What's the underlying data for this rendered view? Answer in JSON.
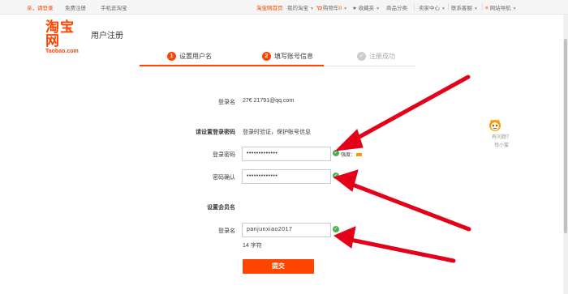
{
  "topbar": {
    "greeting": "亲，请登录",
    "free_register": "免费注册",
    "mobile": "手机逛淘宝",
    "home": "淘宝网首页",
    "my_taobao": "我的淘宝",
    "cart": "购物车",
    "cart_count": "0",
    "favorites": "收藏夹",
    "categories": "商品分类",
    "seller": "卖家中心",
    "service": "联系客服",
    "site_nav": "网站导航"
  },
  "header": {
    "logo_cn": "淘宝网",
    "logo_en": "Taobao.com",
    "title": "用户注册"
  },
  "steps": [
    {
      "num": "1",
      "label": "设置用户名"
    },
    {
      "num": "2",
      "label": "填写账号信息"
    },
    {
      "num": "✓",
      "label": "注册成功"
    }
  ],
  "form": {
    "account_label": "登录名",
    "account_value": "27€   21791@qq.com",
    "password_section": "请设置登录密码",
    "password_section_note": "登录时验证，保护账号信息",
    "password_label": "登录密码",
    "password_value": "•••••••••••••",
    "strength_label": "强度：",
    "confirm_label": "密码确认",
    "confirm_value": "•••••••••••••",
    "member_section": "设置会员名",
    "username_label": "登录名",
    "username_value": "panjunxiao2017",
    "username_hint": "14 字符",
    "submit": "提交"
  },
  "helper": {
    "line1": "有问题？",
    "line2": "找小蜜"
  },
  "colors": {
    "brand": "#ff4400",
    "success": "#4caf50",
    "arrow": "#e5001a"
  }
}
